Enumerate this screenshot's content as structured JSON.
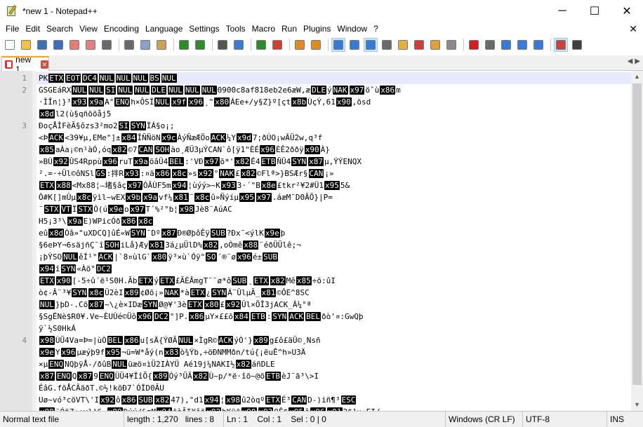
{
  "window": {
    "title": "*new 1 - Notepad++",
    "minimize": "─",
    "maximize": "☐",
    "close": "✕"
  },
  "menu": [
    "File",
    "Edit",
    "Search",
    "View",
    "Encoding",
    "Language",
    "Settings",
    "Tools",
    "Macro",
    "Run",
    "Plugins",
    "Window",
    "?"
  ],
  "menu_close": "✕",
  "toolbar": [
    {
      "name": "new-file-icon",
      "color": "#ffffff"
    },
    {
      "name": "open-file-icon",
      "color": "#f2c04a"
    },
    {
      "name": "save-icon",
      "color": "#3f6fb6"
    },
    {
      "name": "save-all-icon",
      "color": "#3f6fb6"
    },
    {
      "name": "close-icon",
      "color": "#e37f7f"
    },
    {
      "name": "close-all-icon",
      "color": "#e37f7f"
    },
    {
      "name": "print-icon",
      "color": "#6a6a6a"
    },
    {
      "sep": true
    },
    {
      "name": "cut-icon",
      "color": "#6a6a6a"
    },
    {
      "name": "copy-icon",
      "color": "#8aa3c4"
    },
    {
      "name": "paste-icon",
      "color": "#c8a25a"
    },
    {
      "sep": true
    },
    {
      "name": "undo-icon",
      "color": "#2d8a2d"
    },
    {
      "name": "redo-icon",
      "color": "#2d8a2d"
    },
    {
      "sep": true
    },
    {
      "name": "find-icon",
      "color": "#555555"
    },
    {
      "name": "replace-icon",
      "color": "#3b7bd4"
    },
    {
      "sep": true
    },
    {
      "name": "zoom-in-icon",
      "color": "#2d8a2d"
    },
    {
      "name": "zoom-out-icon",
      "color": "#d04030"
    },
    {
      "sep": true
    },
    {
      "name": "sync-vertical-icon",
      "color": "#e08a2a"
    },
    {
      "name": "sync-horizontal-icon",
      "color": "#e08a2a"
    },
    {
      "sep": true
    },
    {
      "name": "word-wrap-icon",
      "color": "#3b7bd4",
      "active": true
    },
    {
      "name": "show-all-chars-icon",
      "color": "#3b7bd4"
    },
    {
      "name": "indent-guide-icon",
      "color": "#3b7bd4",
      "active": true
    },
    {
      "name": "user-language-icon",
      "color": "#6a6a6a"
    },
    {
      "name": "doc-map-icon",
      "color": "#e0b040"
    },
    {
      "name": "function-list-icon",
      "color": "#c84040"
    },
    {
      "name": "folder-workspace-icon",
      "color": "#e0a040"
    },
    {
      "name": "monitoring-icon",
      "color": "#8a8a8a"
    },
    {
      "sep": true
    },
    {
      "name": "record-macro-icon",
      "color": "#d02020"
    },
    {
      "name": "stop-macro-icon",
      "color": "#6a6a6a"
    },
    {
      "name": "play-macro-icon",
      "color": "#3b7bd4"
    },
    {
      "name": "run-macro-multiple-icon",
      "color": "#3b7bd4"
    },
    {
      "name": "save-macro-icon",
      "color": "#3b7bd4"
    },
    {
      "sep": true
    },
    {
      "name": "spell-check-icon",
      "color": "#c84040",
      "active": true
    },
    {
      "name": "heading-icon",
      "color": "#404040"
    }
  ],
  "tab": {
    "label": "new 1",
    "close": "✕"
  },
  "editor": {
    "lines": [
      {
        "num": "1",
        "text": "PK\u0003\u0004\u0014\u0000\u0000\u0000\b\u0000"
      },
      {
        "num": "2",
        "text": "GSGEáRX\u0000\u0000\u000f\u0000\u0000\u0010\u0000\u0000\u00000900c8af818eb2e6æW,æ\u0010ý\u0015öˆùm"
      },
      {
        "num": "",
        "text": "˓ÌÎn¦}³A°\u0005h×ÔSÏ\u0000¸°ÁEe+/y§Z}º[çtÙçÝ,61,õsd"
      },
      {
        "num": "",
        "text": "l2(ù§qñõõåj5"
      },
      {
        "num": "3",
        "text": "ÐoçÅÌFèÃ§ôzs3²mo2\u000f\u0016ÏÁ§o¡;"
      },
      {
        "num": "",
        "text": "<Þ\u0006<39¥µ,EMe\"]±ÎÑÑöNÀýÑæÆÖo\u0006¼Y7;ðÚO¡wÂÜ2w,q³f"
      },
      {
        "num": "",
        "text": "aÀa¡©n¹àÓ,óq©7\u0018\u0001ào¸ÆÜ3µÝCAN`ô[ÿ1\"ÈÉÈÊ2ððÿÀ}"
      },
      {
        "num": "",
        "text": "»BÙÛS4RppùruTöâÜ4\u0007:'VÐõ*'Ê4\u0017ÑÜ4\u0016µ,ÝÝENQX"
      },
      {
        "num": "",
        "text": "².=·÷Ül©ôNSl\u001d:拌R:¤ä»s°\u0015£©Flª>}BSÆr§\u0018¡»"
      },
      {
        "num": "",
        "text": "\u0003<Mx88¦–堵§âçÓÂÙF5m¦ùýý>~K3·´\"B£tkr²¥2#Ü15&"
      },
      {
        "num": "",
        "text": "Ô#K[]mÛµÿìl~wEXvf¼¨û»Ñýíµ.áæM¯D0ÂÕ}|P="
      },
      {
        "num": "",
        "text": "¨\u0002\u000bÏ\u0002Ó(úoT´%²°b¦Jè8¨AúAC"
      },
      {
        "num": "",
        "text": "H5¡3³\\E)WPicÓð"
      },
      {
        "num": "",
        "text": "eûÒâ»\"uXDCQ]ûÉ«W\u0016¯DºÐ®ØþôÊÿ\u001a?Ðx¯<ýlKþ"
      },
      {
        "num": "",
        "text": "§6eÞY¬6säjñÇ¨î\u0001iLå}Æy3á¿µÜlD%,oÒmê¨éðÜÜlê;¬"
      },
      {
        "num": "",
        "text": "¡þÝSO\u0000êÍ¹°\u0006|`8¤ùlG`ÿ³×ù`Óÿ\"\u000e´®¨øé±\u001a"
      },
      {
        "num": "",
        "text": "î\u0016«Àõ°\u0012"
      },
      {
        "num": "",
        "text": "\u0003[-5÷û´ë¹S0H.Ãb\u0003ý\u0003£ÃÉÂmgT¨¨ø*ô\u001a¸\u0003Mê÷õ:ûI"
      },
      {
        "num": "",
        "text": "ò¢-Â¨³¥\u0016Ü2èI¢Øõ¡»\u0015*à\u0003¿\u0016Á¨ÛlµÃ_©ÔE^8SC"
      },
      {
        "num": "",
        "text": "\u0000}þD-.Cõ~\\¿è×IDæ\u0016Ø@¥'3è\u0003£Ûl×ÕÎ3jACK_Á¼°ª"
      },
      {
        "num": "",
        "text": "§SgËNè$R0¥.Ve~ÈUÙé©Üô\u0012°]P.µY×££õ\u0017:\u0016\u0006\u0007ðò'¤:GwQþ"
      },
      {
        "num": "",
        "text": "ÿ`½S0HkÁ"
      },
      {
        "num": "4",
        "text": "ÙÜ4Va=Þ=|ùÒ\u0007u[sÄ{ÝØÃ\u0000×ÌgR©\u0006ýÒ'}g£ô£äÜ©¸Nsñ"
      },
      {
        "num": "",
        "text": "Yµæýþ9f¬ü=W*åý(nò¾Ýb,÷öÐNMMðn/tú{¡ëuÊ^h»U3Ä"
      },
      {
        "num": "",
        "text": "×µ\u0005NQþÿÅ-/ðûB\u0000üæö¤ìÜ2IÀYÜ Aé19j¼NAKI½áñDLE"
      },
      {
        "num": "",
        "text": "\u0005Q9\u0005ÜÜ4¥ÏîÕ{Óý³ÜÃÙ~p/*ë·îõ~@õ\u0017èJ¨ã³\\>I"
      },
      {
        "num": "",
        "text": "ÉâG.fõÅCÂãðT.©½!kõÐ7`ÓÏD0ÃU"
      },
      {
        "num": "",
        "text": "Uø~vó³cõVT\\'Iô\u001a47),°d1¦û2òqº\u0003É³\u0018D-)iñ¶³\u001b"
      },
      {
        "num": "",
        "text": "¨ÓäZ:;v}!6·Ðúú/&zMõàÃIXôãhKü°9Ê$ô2$]×»EI/"
      },
      {
        "num": "",
        "text": "4óã¬tx)TýEç=S£ÅLRÕë>¨öÖÝ÷ª\u0000;sQçÜ19|©¤\u0002÷û?cð¨"
      }
    ]
  },
  "statusbar": {
    "type": "Normal text file",
    "length": "length : 1,270",
    "lines": "lines : 8",
    "position": "Ln : 1    Col : 1    Sel : 0 | 0",
    "eol": "Windows (CR LF)",
    "encoding": "UTF-8",
    "mode": "INS"
  }
}
